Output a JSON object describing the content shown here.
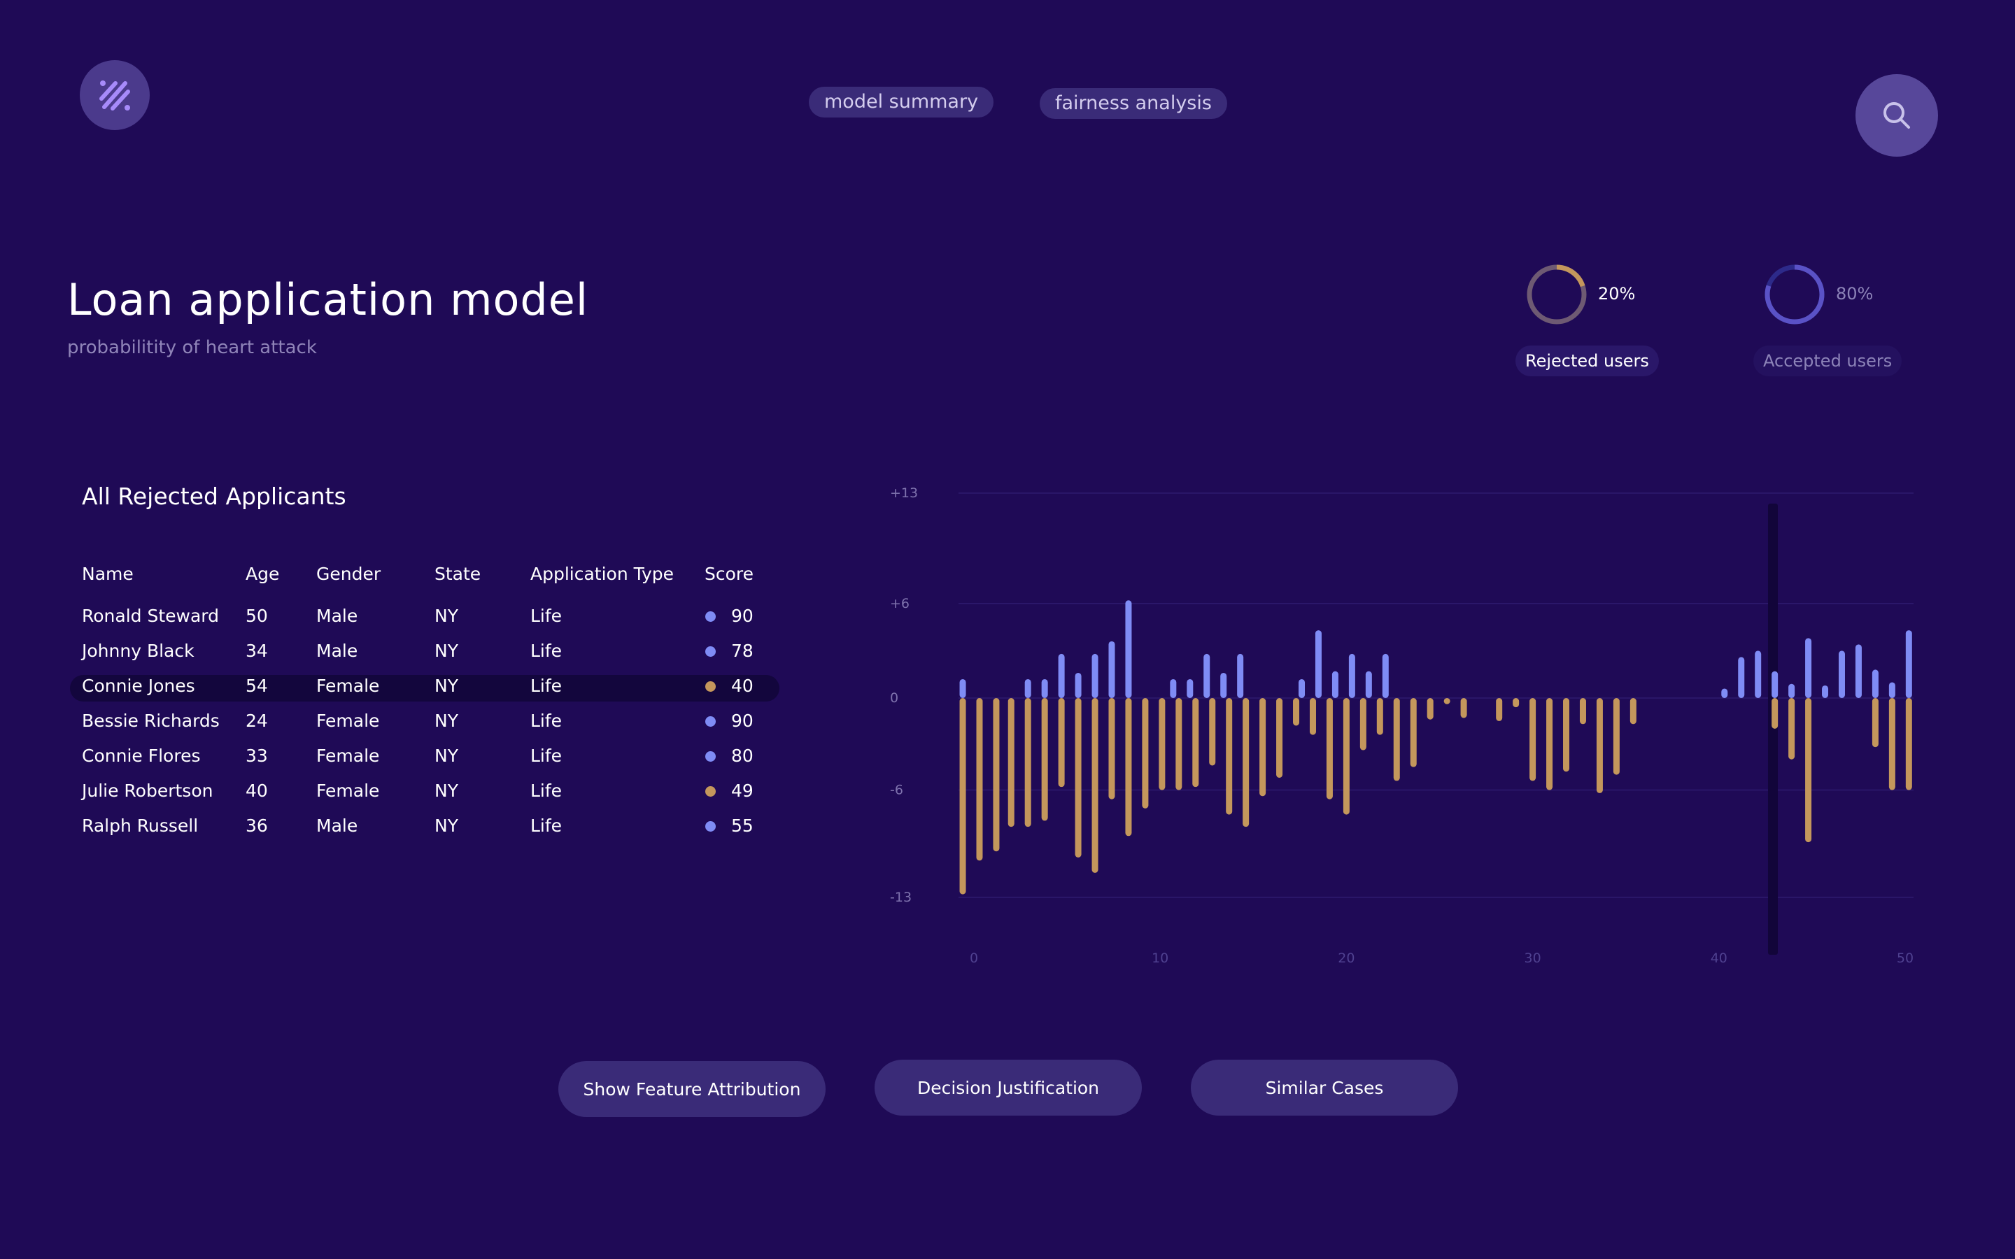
{
  "app": {
    "logo_icon": "percent-slash-icon",
    "search_icon": "search-icon"
  },
  "nav": {
    "tabs": [
      {
        "label": "model summary"
      },
      {
        "label": "fairness analysis"
      }
    ]
  },
  "header": {
    "title": "Loan application model",
    "subtitle": "probabilitity of heart attack"
  },
  "stats": [
    {
      "value": "20%",
      "fraction": 0.2,
      "label": "Rejected users",
      "color": "#c4975c"
    },
    {
      "value": "80%",
      "fraction": 0.8,
      "label": "Accepted users",
      "color": "#5a52c6"
    }
  ],
  "table": {
    "title": "All Rejected Applicants",
    "columns": [
      "Name",
      "Age",
      "Gender",
      "State",
      "Application Type",
      "Score"
    ],
    "rows": [
      {
        "name": "Ronald Steward",
        "age": "50",
        "gender": "Male",
        "state": "NY",
        "type": "Life",
        "score": "90",
        "status": "accepted"
      },
      {
        "name": "Johnny Black",
        "age": "34",
        "gender": "Male",
        "state": "NY",
        "type": "Life",
        "score": "78",
        "status": "accepted"
      },
      {
        "name": "Connie Jones",
        "age": "54",
        "gender": "Female",
        "state": "NY",
        "type": "Life",
        "score": "40",
        "status": "rejected"
      },
      {
        "name": "Bessie Richards",
        "age": "24",
        "gender": "Female",
        "state": "NY",
        "type": "Life",
        "score": "90",
        "status": "accepted"
      },
      {
        "name": "Connie Flores",
        "age": "33",
        "gender": "Female",
        "state": "NY",
        "type": "Life",
        "score": "80",
        "status": "accepted"
      },
      {
        "name": "Julie Robertson",
        "age": "40",
        "gender": "Female",
        "state": "NY",
        "type": "Life",
        "score": "49",
        "status": "rejected"
      },
      {
        "name": "Ralph Russell",
        "age": "36",
        "gender": "Male",
        "state": "NY",
        "type": "Life",
        "score": "55",
        "status": "accepted"
      }
    ]
  },
  "colors": {
    "accepted": "#7f8cf5",
    "rejected": "#c4975c",
    "background": "#1f0a56"
  },
  "chart_data": {
    "type": "bar",
    "ylim": [
      -13,
      13
    ],
    "xlim": [
      0,
      50
    ],
    "y_ticks": [
      "+13",
      "+6",
      "0",
      "-6",
      "-13"
    ],
    "y_tick_values": [
      13,
      6,
      0,
      -6,
      -13
    ],
    "x_ticks": [
      "0",
      "10",
      "20",
      "30",
      "40",
      "50"
    ],
    "x_tick_values": [
      0,
      10,
      20,
      30,
      40,
      50
    ],
    "highlight_x": 42.9,
    "series": [
      {
        "color": "#7f8cf5",
        "points": [
          [
            -0.6,
            1.2
          ],
          [
            2.9,
            1.2
          ],
          [
            3.8,
            1.2
          ],
          [
            4.7,
            2.8
          ],
          [
            5.6,
            1.6
          ],
          [
            6.5,
            2.8
          ],
          [
            7.4,
            3.6
          ],
          [
            8.3,
            6.2
          ],
          [
            10.7,
            1.2
          ],
          [
            11.6,
            1.2
          ],
          [
            12.5,
            2.8
          ],
          [
            13.4,
            1.6
          ],
          [
            14.3,
            2.8
          ],
          [
            17.6,
            1.2
          ],
          [
            18.5,
            4.3
          ],
          [
            19.4,
            1.7
          ],
          [
            20.3,
            2.8
          ],
          [
            21.2,
            1.7
          ],
          [
            22.1,
            2.8
          ],
          [
            40.3,
            0.6
          ],
          [
            41.2,
            2.6
          ],
          [
            42.1,
            3.0
          ],
          [
            43.0,
            1.7
          ],
          [
            43.9,
            0.9
          ],
          [
            44.8,
            3.8
          ],
          [
            45.7,
            0.8
          ],
          [
            46.6,
            3.0
          ],
          [
            47.5,
            3.4
          ],
          [
            48.4,
            1.8
          ],
          [
            49.3,
            1.0
          ],
          [
            50.2,
            4.3
          ]
        ]
      },
      {
        "color": "#c4975c",
        "points": [
          [
            -0.6,
            -12.8
          ],
          [
            0.3,
            -10.6
          ],
          [
            1.2,
            -10.0
          ],
          [
            2.0,
            -8.4
          ],
          [
            2.9,
            -8.4
          ],
          [
            3.8,
            -8.0
          ],
          [
            4.7,
            -5.8
          ],
          [
            5.6,
            -10.4
          ],
          [
            6.5,
            -11.4
          ],
          [
            7.4,
            -6.6
          ],
          [
            8.3,
            -9.0
          ],
          [
            9.2,
            -7.2
          ],
          [
            10.1,
            -6.0
          ],
          [
            11.0,
            -6.0
          ],
          [
            11.9,
            -5.8
          ],
          [
            12.8,
            -4.4
          ],
          [
            13.7,
            -7.6
          ],
          [
            14.6,
            -8.4
          ],
          [
            15.5,
            -6.4
          ],
          [
            16.4,
            -5.2
          ],
          [
            17.3,
            -1.8
          ],
          [
            18.2,
            -2.4
          ],
          [
            19.1,
            -6.6
          ],
          [
            20.0,
            -7.6
          ],
          [
            20.9,
            -3.4
          ],
          [
            21.8,
            -2.4
          ],
          [
            22.7,
            -5.4
          ],
          [
            23.6,
            -4.5
          ],
          [
            24.5,
            -1.4
          ],
          [
            25.4,
            -0.4
          ],
          [
            26.3,
            -1.3
          ],
          [
            28.2,
            -1.5
          ],
          [
            29.1,
            -0.6
          ],
          [
            30.0,
            -5.4
          ],
          [
            30.9,
            -6.0
          ],
          [
            31.8,
            -4.8
          ],
          [
            32.7,
            -1.7
          ],
          [
            33.6,
            -6.2
          ],
          [
            34.5,
            -5.0
          ],
          [
            35.4,
            -1.7
          ],
          [
            43.0,
            -2.0
          ],
          [
            43.9,
            -4.0
          ],
          [
            44.8,
            -9.4
          ],
          [
            48.4,
            -3.2
          ],
          [
            49.3,
            -6.0
          ],
          [
            50.2,
            -6.0
          ]
        ]
      }
    ]
  },
  "actions": [
    {
      "label": "Show Feature Attribution"
    },
    {
      "label": "Decision Justification"
    },
    {
      "label": "Similar Cases"
    }
  ]
}
